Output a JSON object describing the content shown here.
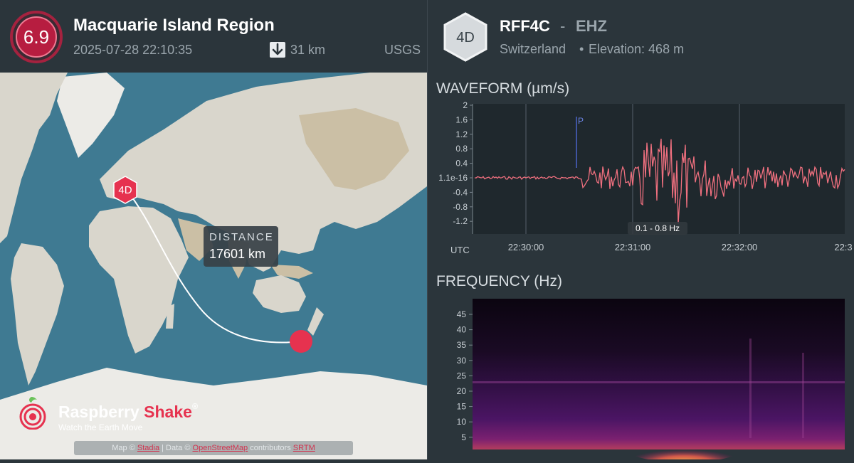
{
  "event": {
    "magnitude": "6.9",
    "title": "Macquarie Island Region",
    "datetime": "2025-07-28 22:10:35",
    "depth": "31 km",
    "source": "USGS",
    "depth_icon": "arrow-down-icon"
  },
  "map": {
    "station_marker_label": "4D",
    "distance_label": "DISTANCE",
    "distance_value": "17601 km",
    "colors": {
      "ocean": "#3f7a92",
      "land": "#d9d6cc",
      "ice": "#ecebe7",
      "path": "#ffffff",
      "marker": "#e6324f"
    }
  },
  "brand": {
    "name_part1": "Raspberry ",
    "name_part2": "Shake",
    "registered": "®",
    "tagline": "Watch the Earth Move"
  },
  "attribution": {
    "prefix": "Map © ",
    "map_link": "Stadia",
    "data_prefix": " | Data © ",
    "osm_link": "OpenStreetMap",
    "contributors": " contributors ",
    "srtm_link": "SRTM"
  },
  "station": {
    "badge": "4D",
    "code": "RFF4C",
    "dash": "-",
    "channel": "EHZ",
    "country": "Switzerland",
    "dot": "•",
    "elevation": "Elevation: 468 m"
  },
  "waveform": {
    "title": "WAVEFORM (µm/s)",
    "filter_label": "0.1 - 0.8 Hz",
    "phase_label": "P",
    "utc_label": "UTC",
    "line_color": "#f0707f",
    "y_ticks": [
      "2",
      "1.6",
      "1.2",
      "0.8",
      "0.4",
      "1.1e-16",
      "-0.4",
      "-0.8",
      "-1.2"
    ],
    "time_ticks": [
      "22:30:00",
      "22:31:00",
      "22:32:00",
      "22:3"
    ]
  },
  "frequency": {
    "title": "FREQUENCY (Hz)",
    "y_ticks": [
      "45",
      "40",
      "35",
      "30",
      "25",
      "20",
      "15",
      "10",
      "5"
    ],
    "colors": {
      "background": "#0b0510",
      "mid": "#4b1564",
      "high": "#f6a84a"
    }
  }
}
